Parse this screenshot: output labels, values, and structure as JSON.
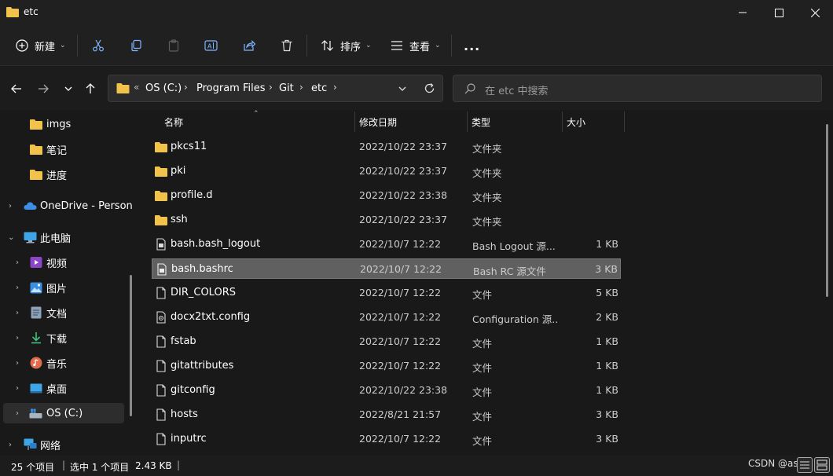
{
  "window": {
    "title": "etc",
    "controls": [
      "minimize",
      "maximize",
      "close"
    ]
  },
  "toolbar": {
    "new_label": "新建",
    "sort_label": "排序",
    "view_label": "查看",
    "more_label": "...",
    "icons": [
      "cut-icon",
      "copy-icon",
      "paste-icon",
      "rename-icon",
      "share-icon",
      "delete-icon"
    ]
  },
  "address": {
    "prefix": "«",
    "crumbs": [
      "OS (C:)",
      "Program Files",
      "Git",
      "etc"
    ]
  },
  "search": {
    "placeholder": "在 etc 中搜索"
  },
  "sidebar": {
    "items": [
      {
        "label": "imgs",
        "icon": "folder-icon",
        "indent": 2
      },
      {
        "label": "笔记",
        "icon": "folder-icon",
        "indent": 2
      },
      {
        "label": "进度",
        "icon": "folder-icon",
        "indent": 2
      },
      {
        "label": "OneDrive - Person",
        "icon": "onedrive-icon",
        "indent": 1,
        "chevron": "›"
      },
      {
        "label": "此电脑",
        "icon": "computer-icon",
        "indent": 1,
        "chevron": "⌄"
      },
      {
        "label": "视频",
        "icon": "video-icon",
        "indent": 2,
        "chevron": "›"
      },
      {
        "label": "图片",
        "icon": "pictures-icon",
        "indent": 2,
        "chevron": "›"
      },
      {
        "label": "文档",
        "icon": "documents-icon",
        "indent": 2,
        "chevron": "›"
      },
      {
        "label": "下载",
        "icon": "download-icon",
        "indent": 2,
        "chevron": "›"
      },
      {
        "label": "音乐",
        "icon": "music-icon",
        "indent": 2,
        "chevron": "›"
      },
      {
        "label": "桌面",
        "icon": "desktop-icon",
        "indent": 2,
        "chevron": "›"
      },
      {
        "label": "OS (C:)",
        "icon": "drive-icon",
        "indent": 2,
        "chevron": "›",
        "selected": true
      },
      {
        "label": "网络",
        "icon": "network-icon",
        "indent": 1,
        "chevron": "›"
      }
    ]
  },
  "columns": [
    "名称",
    "修改日期",
    "类型",
    "大小"
  ],
  "files": [
    {
      "name": "pkcs11",
      "date": "2022/10/22 23:37",
      "type": "文件夹",
      "size": "",
      "icon": "folder-icon"
    },
    {
      "name": "pki",
      "date": "2022/10/22 23:37",
      "type": "文件夹",
      "size": "",
      "icon": "folder-icon"
    },
    {
      "name": "profile.d",
      "date": "2022/10/22 23:38",
      "type": "文件夹",
      "size": "",
      "icon": "folder-icon"
    },
    {
      "name": "ssh",
      "date": "2022/10/22 23:37",
      "type": "文件夹",
      "size": "",
      "icon": "folder-icon"
    },
    {
      "name": "bash.bash_logout",
      "date": "2022/10/7 12:22",
      "type": "Bash Logout 源...",
      "size": "1 KB",
      "icon": "script-file-icon"
    },
    {
      "name": "bash.bashrc",
      "date": "2022/10/7 12:22",
      "type": "Bash RC 源文件",
      "size": "3 KB",
      "icon": "script-file-icon",
      "selected": true
    },
    {
      "name": "DIR_COLORS",
      "date": "2022/10/7 12:22",
      "type": "文件",
      "size": "5 KB",
      "icon": "file-icon"
    },
    {
      "name": "docx2txt.config",
      "date": "2022/10/7 12:22",
      "type": "Configuration 源...",
      "size": "2 KB",
      "icon": "config-file-icon"
    },
    {
      "name": "fstab",
      "date": "2022/10/7 12:22",
      "type": "文件",
      "size": "1 KB",
      "icon": "file-icon"
    },
    {
      "name": "gitattributes",
      "date": "2022/10/7 12:22",
      "type": "文件",
      "size": "1 KB",
      "icon": "file-icon"
    },
    {
      "name": "gitconfig",
      "date": "2022/10/22 23:38",
      "type": "文件",
      "size": "1 KB",
      "icon": "file-icon"
    },
    {
      "name": "hosts",
      "date": "2022/8/21 21:57",
      "type": "文件",
      "size": "3 KB",
      "icon": "file-icon"
    },
    {
      "name": "inputrc",
      "date": "2022/10/7 12:22",
      "type": "文件",
      "size": "3 KB",
      "icon": "file-icon"
    }
  ],
  "status": {
    "count": "25 个项目",
    "selected": "选中 1 个项目",
    "size": "2.43 KB"
  },
  "watermark": "CSDN @asi   v",
  "colors": {
    "folder": "#f2c34b",
    "selection": "#606060",
    "background": "#191919"
  }
}
